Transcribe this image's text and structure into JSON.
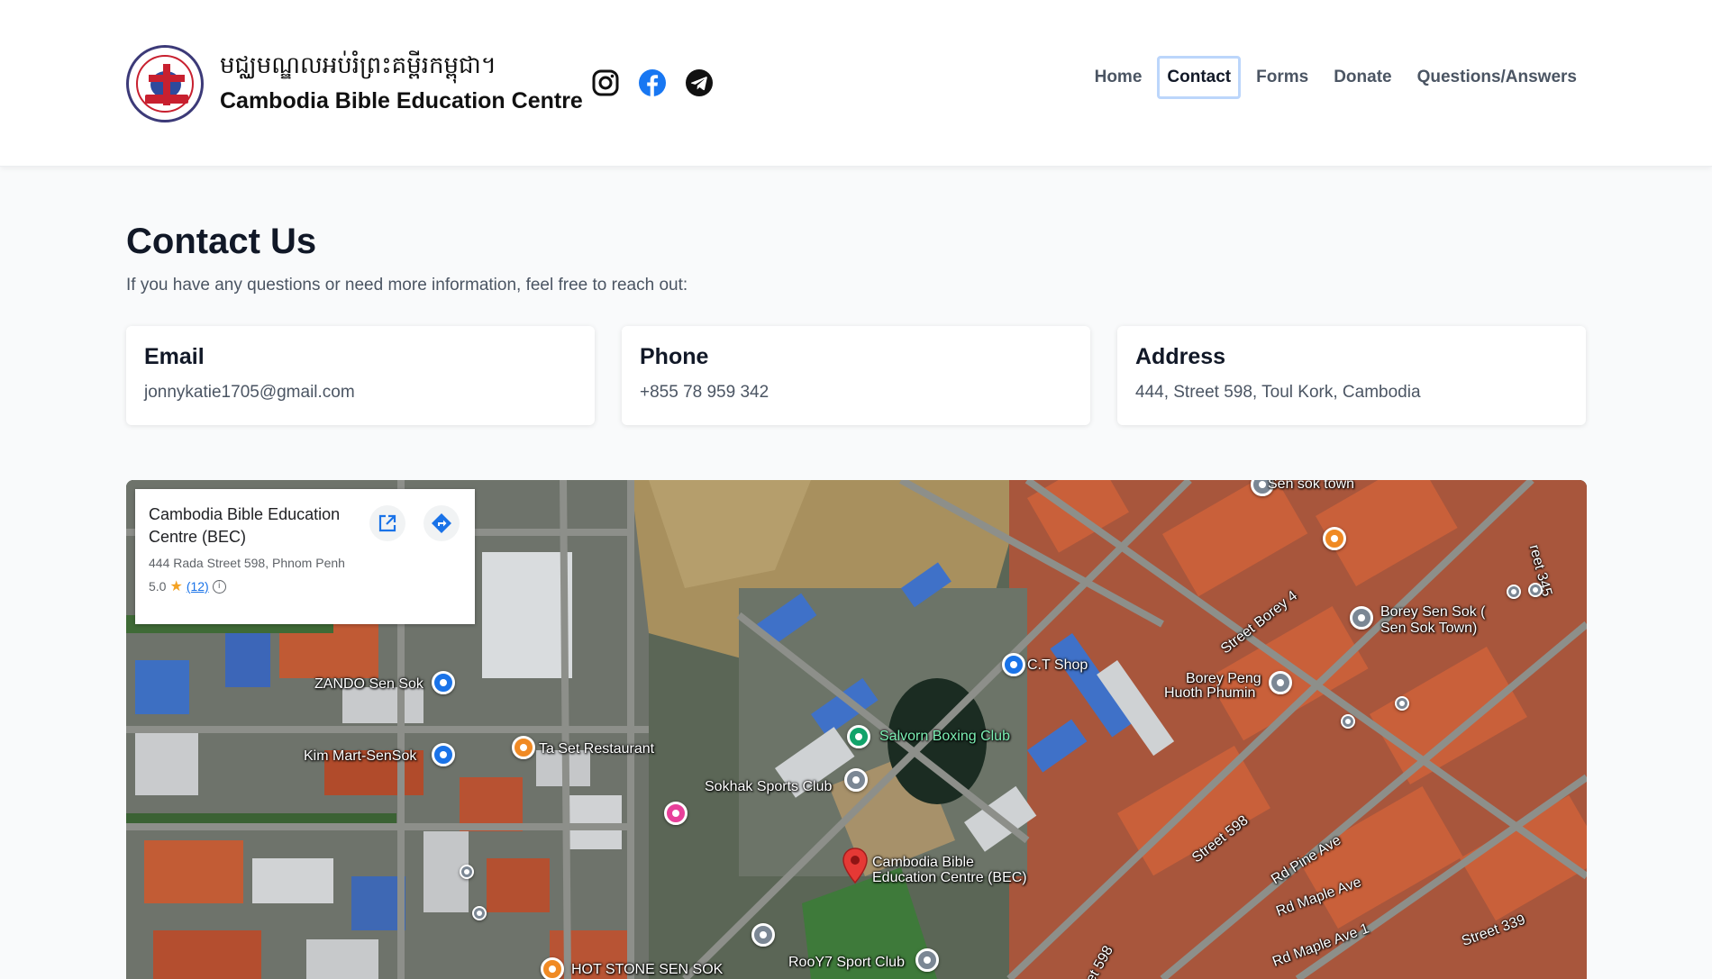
{
  "header": {
    "brand_khmer": "មជ្ឈមណ្ឌលអប់រំព្រះគម្ពីរកម្ពុជា។",
    "brand_name": "Cambodia Bible Education Centre",
    "socials": [
      "instagram-icon",
      "facebook-icon",
      "telegram-icon"
    ],
    "nav": [
      {
        "label": "Home",
        "active": false
      },
      {
        "label": "Contact",
        "active": true
      },
      {
        "label": "Forms",
        "active": false
      },
      {
        "label": "Donate",
        "active": false
      },
      {
        "label": "Questions/Answers",
        "active": false
      }
    ]
  },
  "main": {
    "title": "Contact Us",
    "subtitle": "If you have any questions or need more information, feel free to reach out:",
    "cards": [
      {
        "title": "Email",
        "value": "jonnykatie1705@gmail.com"
      },
      {
        "title": "Phone",
        "value": "+855 78 959 342"
      },
      {
        "title": "Address",
        "value": "444, Street 598, Toul Kork, Cambodia"
      }
    ]
  },
  "map": {
    "place_name": "Cambodia Bible Education Centre (BEC)",
    "place_address": "444 Rada Street 598, Phnom Penh",
    "rating": "5.0",
    "review_count": "(12)",
    "labels": {
      "sen_sok_town": "Sen sok town",
      "borey_sen_sok": "Borey Sen Sok (",
      "borey_sen_sok2": "Sen Sok Town)",
      "ct_shop": "C.T Shop",
      "borey_peng": "Borey Peng",
      "borey_peng2": "Huoth Phumin",
      "zando": "ZANDO Sen Sok",
      "kim_mart": "Kim Mart-SenSok",
      "ta_set": "Ta Set Restaurant",
      "salvorn": "Salvorn Boxing Club",
      "sokhak": "Sokhak Sports Club",
      "bec1": "Cambodia Bible",
      "bec2": "Education Centre (BEC)",
      "rooy7": "RooY7 Sport Club",
      "hot_stone": "HOT STONE SEN SOK",
      "street_borey4": "Street Borey 4",
      "street_598": "Street 598",
      "street_598b": "et 598",
      "rd_pine": "Rd Pine Ave",
      "rd_maple": "Rd Maple Ave",
      "rd_maple1": "Rd Maple Ave 1",
      "street_339": "Street 339",
      "street_345": "reet 345"
    }
  },
  "colors": {
    "nav_active_border": "#bcd6fb",
    "map_pin_red": "#e53935",
    "map_blue_pin": "#1a73e8"
  }
}
